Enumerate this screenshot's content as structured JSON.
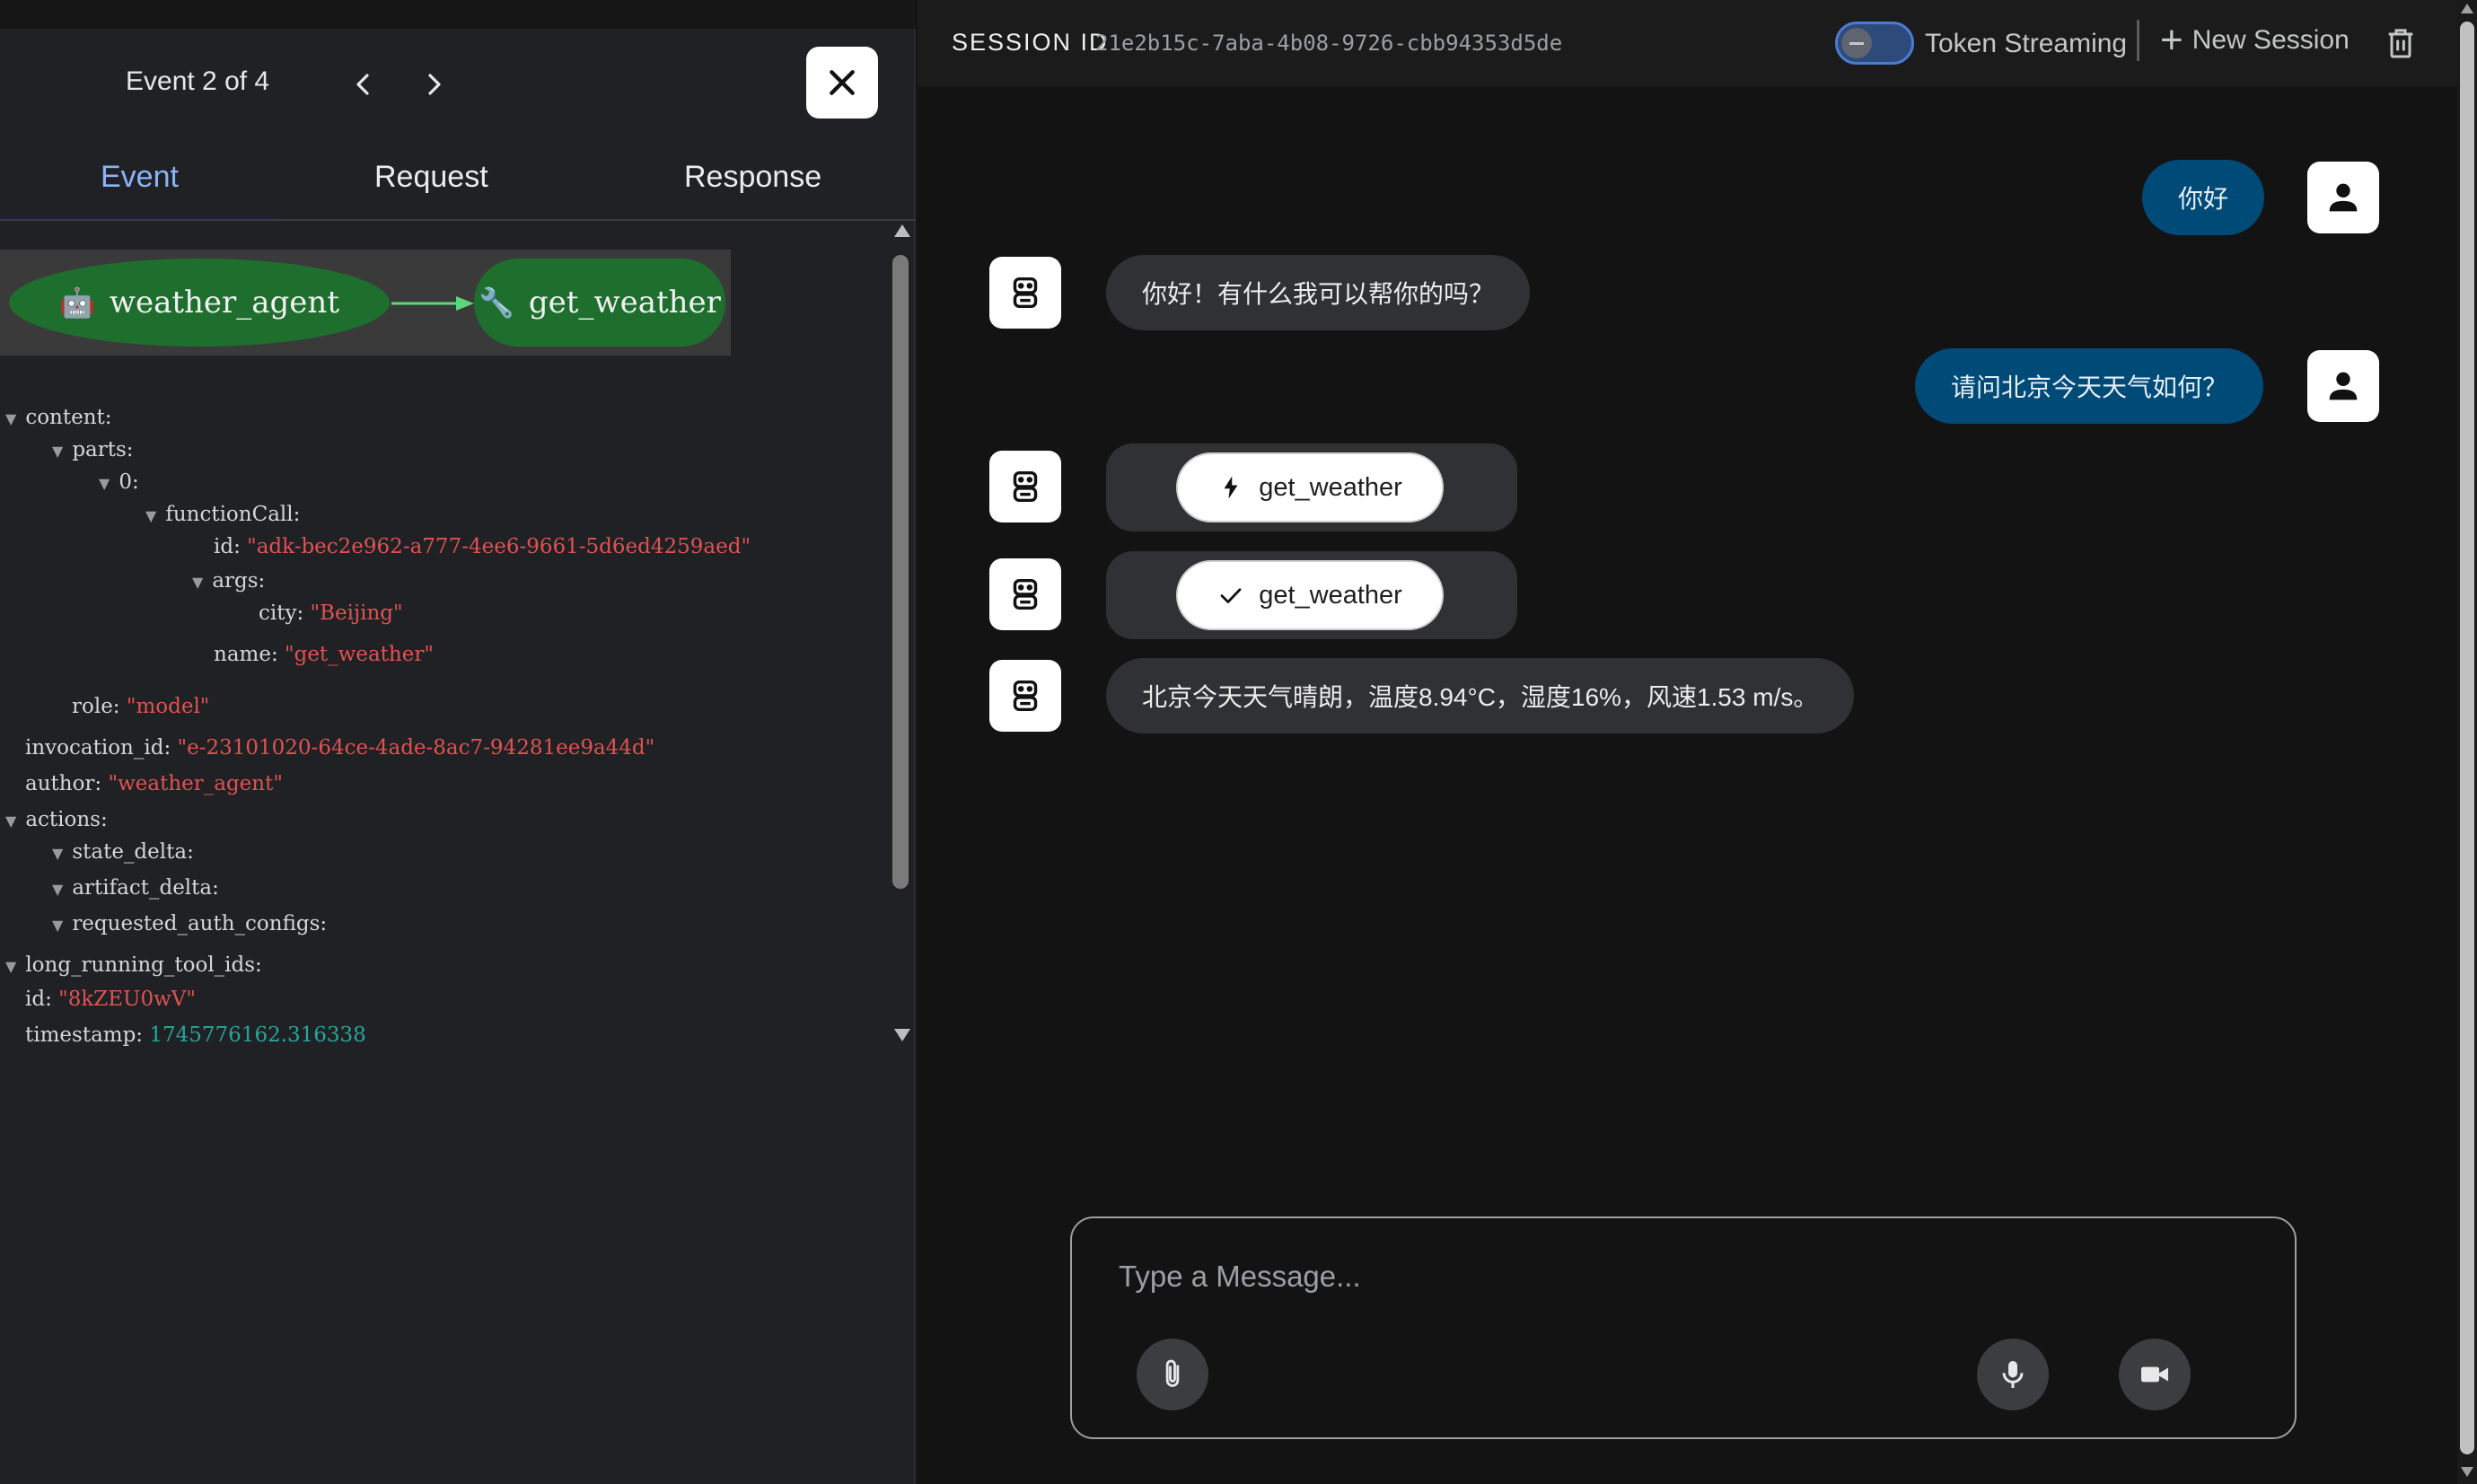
{
  "event_panel": {
    "counter": "Event 2 of 4",
    "tabs": [
      "Event",
      "Request",
      "Response"
    ],
    "active_tab": "Event",
    "graph": {
      "agent_node": "weather_agent",
      "tool_node": "get_weather",
      "agent_icon": "robot-icon",
      "tool_icon": "wrench-icon",
      "node_color": "#1e6f2e",
      "edge_color": "#5cd67a"
    },
    "event_json": {
      "content_key": "content:",
      "parts_key": "parts:",
      "index_key": "0:",
      "function_call_key": "functionCall:",
      "id_key": "id:",
      "function_call_id": "\"adk-bec2e962-a777-4ee6-9661-5d6ed4259aed\"",
      "args_key": "args:",
      "city_key": "city:",
      "city": "\"Beijing\"",
      "name_key": "name:",
      "name": "\"get_weather\"",
      "role_key": "role:",
      "role": "\"model\"",
      "invocation_id_key": "invocation_id:",
      "invocation_id": "\"e-23101020-64ce-4ade-8ac7-94281ee9a44d\"",
      "author_key": "author:",
      "author": "\"weather_agent\"",
      "actions_key": "actions:",
      "state_delta_key": "state_delta:",
      "artifact_delta_key": "artifact_delta:",
      "requested_auth_configs_key": "requested_auth_configs:",
      "long_running_tool_ids_key": "long_running_tool_ids:",
      "event_id_key": "id:",
      "event_id": "\"8kZEU0wV\"",
      "timestamp_key": "timestamp:",
      "timestamp": "1745776162.316338"
    }
  },
  "header": {
    "session_label": "SESSION ID",
    "session_id": "21e2b15c-7aba-4b08-9726-cbb94353d5de",
    "token_streaming_label": "Token Streaming",
    "token_streaming_enabled": false,
    "new_session_label": "New Session"
  },
  "messages": {
    "user_1": "你好",
    "bot_1": "你好！有什么我可以帮你的吗？",
    "user_2": "请问北京今天天气如何？",
    "tool_call": "get_weather",
    "tool_result": "get_weather",
    "bot_2": "北京今天天气晴朗，温度8.94°C，湿度16%，风速1.53 m/s。"
  },
  "composer": {
    "placeholder": "Type a Message..."
  },
  "colors": {
    "user_bubble": "#004a77",
    "bot_bubble": "#303134",
    "active_tab": "#8ab4f8",
    "json_string": "#e05252",
    "json_number": "#26a69a"
  }
}
